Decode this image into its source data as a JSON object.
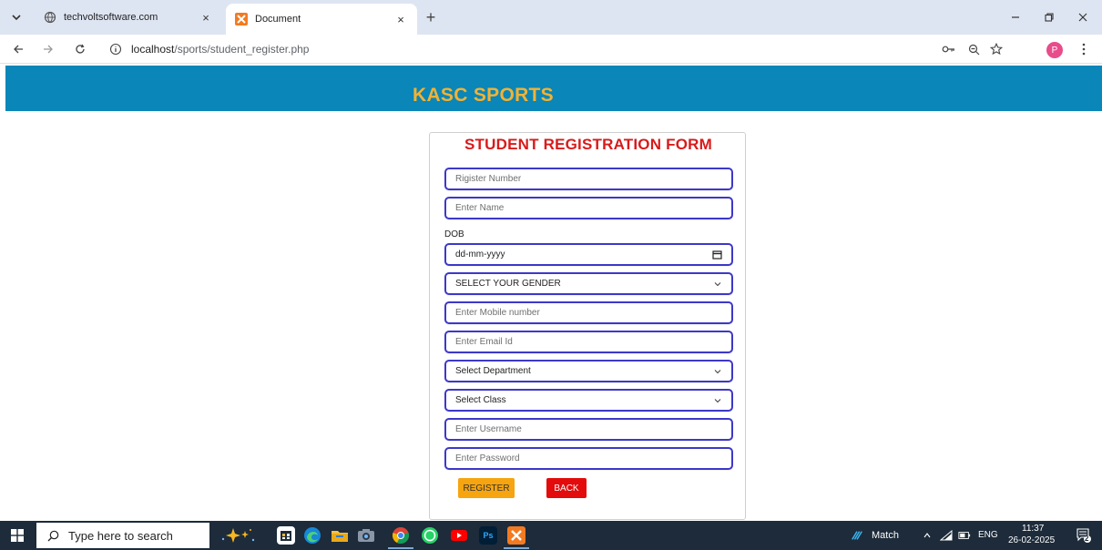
{
  "browser": {
    "tabs": [
      {
        "title": "techvoltsoftware.com",
        "close": "×"
      },
      {
        "title": "Document",
        "close": "×"
      }
    ],
    "new_tab": "+",
    "url_host": "localhost",
    "url_path": "/sports/student_register.php"
  },
  "site": {
    "title": "KASC SPORTS"
  },
  "form": {
    "heading": "STUDENT REGISTRATION FORM",
    "register_number_placeholder": "Rigister Number",
    "name_placeholder": "Enter Name",
    "dob_label": "DOB",
    "dob_value": "dd-mm-yyyy",
    "gender_selected": "SELECT YOUR GENDER",
    "mobile_placeholder": "Enter Mobile number",
    "email_placeholder": "Enter Email Id",
    "department_selected": "Select Department",
    "class_selected": "Select Class",
    "username_placeholder": "Enter Username",
    "password_placeholder": "Enter Password",
    "register_label": "REGISTER",
    "back_label": "BACK"
  },
  "taskbar": {
    "search_placeholder": "Type here to search",
    "weather_text": "Match",
    "language": "ENG",
    "time": "11:37",
    "date": "26-02-2025",
    "notification_count": "2"
  },
  "colors": {
    "header_bg": "#0a86b8",
    "title_color": "#f2b234",
    "heading_color": "#d81b1b",
    "field_border": "#3d38c8",
    "register_bg": "#f6a410",
    "back_bg": "#e30b0b"
  }
}
